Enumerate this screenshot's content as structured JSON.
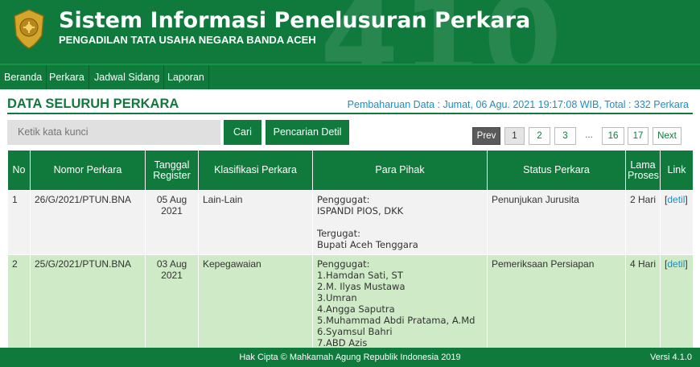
{
  "header": {
    "title": "Sistem Informasi Penelusuran Perkara",
    "subtitle": "PENGADILAN TATA USAHA NEGARA BANDA ACEH",
    "bg_number": "410"
  },
  "nav": {
    "items": [
      "Beranda",
      "Perkara",
      "Jadwal Sidang",
      "Laporan"
    ]
  },
  "page": {
    "heading": "DATA SELURUH PERKARA",
    "update_info": "Pembaharuan Data : Jumat, 06 Agu. 2021 19:17:08 WIB, Total : 332 Perkara"
  },
  "search": {
    "placeholder": "Ketik kata kunci",
    "search_label": "Cari",
    "detail_label": "Pencarian Detil"
  },
  "pagination": {
    "prev": "Prev",
    "pages": [
      "1",
      "2",
      "3"
    ],
    "ellipsis": "...",
    "last_pages": [
      "16",
      "17"
    ],
    "next": "Next"
  },
  "table": {
    "headers": [
      "No",
      "Nomor Perkara",
      "Tanggal Register",
      "Klasifikasi Perkara",
      "Para Pihak",
      "Status Perkara",
      "Lama Proses",
      "Link"
    ],
    "rows": [
      {
        "no": "1",
        "nomor": "26/G/2021/PTUN.BNA",
        "tanggal": "05 Aug 2021",
        "klasifikasi": "Lain-Lain",
        "para_pihak": "Penggugat:\nISPANDI PIOS, DKK\n\nTergugat:\nBupati Aceh Tenggara",
        "status": "Penunjukan Jurusita",
        "lama": "2 Hari",
        "link_open": "[",
        "link": "detil",
        "link_close": "]"
      },
      {
        "no": "2",
        "nomor": "25/G/2021/PTUN.BNA",
        "tanggal": "03 Aug 2021",
        "klasifikasi": "Kepegawaian",
        "para_pihak": "Penggugat:\n1.Hamdan Sati, ST\n2.M. Ilyas Mustawa\n3.Umran\n4.Angga Saputra\n5.Muhammad Abdi Pratama, A.Md\n6.Syamsul Bahri\n7.ABD Azis",
        "status": "Pemeriksaan Persiapan",
        "lama": "4 Hari",
        "link_open": "[",
        "link": "detil",
        "link_close": "]"
      }
    ]
  },
  "footer": {
    "copyright": "Hak Cipta © Mahkamah Agung Republik Indonesia 2019",
    "version": "Versi 4.1.0"
  },
  "colors": {
    "brand_green": "#0f7a3c",
    "row_green": "#cfeac6",
    "row_grey": "#f2f2f2",
    "link_blue": "#1a8fbf"
  }
}
